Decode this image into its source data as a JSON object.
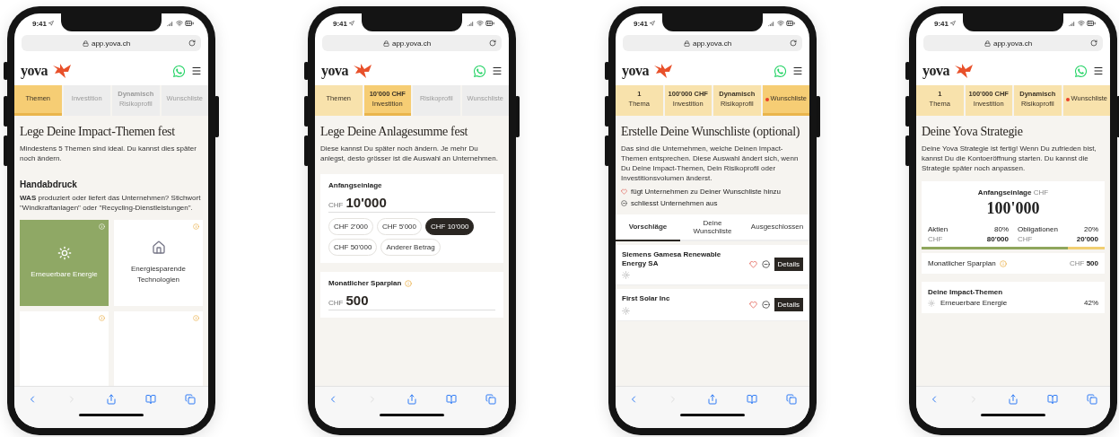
{
  "phones": [
    {
      "status_time": "9:41",
      "url": "app.yova.ch",
      "logo": "yova",
      "tabs": [
        {
          "label": "Themen",
          "done": true,
          "selected": true,
          "dot": false
        },
        {
          "label": "Investition",
          "done": false,
          "selected": false,
          "dot": false
        },
        {
          "title": "Dynamisch",
          "label": "Risikoprofil",
          "done": false,
          "selected": false,
          "dot": false
        },
        {
          "label": "Wunschliste",
          "done": false,
          "selected": false,
          "dot": false
        }
      ],
      "content": {
        "kind": "themes",
        "heading": "Lege Deine Impact-Themen fest",
        "intro": "Mindestens 5 Themen sind ideal. Du kannst dies später noch ändern.",
        "section_title": "Handabdruck",
        "section_text": "**WAS** produziert oder liefert das Unternehmen? Stichwort \"Windkraftanlagen\" oder \"Recycling-Dienstleistungen\".",
        "cards": [
          {
            "label": "Erneuerbare Energie",
            "selected": true
          },
          {
            "label": "Energiesparende Technologien",
            "selected": false
          },
          {
            "selected": false
          },
          {
            "selected": false
          }
        ]
      }
    },
    {
      "status_time": "9:41",
      "url": "app.yova.ch",
      "logo": "yova",
      "tabs": [
        {
          "label": "Themen",
          "done": true,
          "selected": false,
          "dot": false
        },
        {
          "title": "10'000 CHF",
          "label": "Investition",
          "done": true,
          "selected": true,
          "dot": false
        },
        {
          "label": "Risikoprofil",
          "done": false,
          "selected": false,
          "dot": false
        },
        {
          "label": "Wunschliste",
          "done": false,
          "selected": false,
          "dot": false
        }
      ],
      "content": {
        "kind": "amount",
        "heading": "Lege Deine Anlagesumme fest",
        "intro": "Diese kannst Du später noch ändern. Je mehr Du anlegst, desto grösser ist die Auswahl an Unternehmen.",
        "fields": [
          {
            "label": "Anfangseinlage",
            "info": false,
            "currency": "CHF",
            "value": "10'000",
            "chips": [
              {
                "label": "CHF 2'000",
                "selected": false
              },
              {
                "label": "CHF 5'000",
                "selected": false
              },
              {
                "label": "CHF 10'000",
                "selected": true
              },
              {
                "label": "CHF 50'000",
                "selected": false
              },
              {
                "label": "Anderer Betrag",
                "selected": false
              }
            ]
          },
          {
            "label": "Monatlicher Sparplan",
            "info": true,
            "currency": "CHF",
            "value": "500"
          }
        ]
      }
    },
    {
      "status_time": "9:41",
      "url": "app.yova.ch",
      "logo": "yova",
      "tabs": [
        {
          "title": "1",
          "label": "Thema",
          "done": true,
          "selected": false,
          "dot": false
        },
        {
          "title": "100'000 CHF",
          "label": "Investition",
          "done": true,
          "selected": false,
          "dot": false
        },
        {
          "title": "Dynamisch",
          "label": "Risikoprofil",
          "done": true,
          "selected": false,
          "dot": false
        },
        {
          "label": "Wunschliste",
          "done": true,
          "selected": true,
          "dot": true
        }
      ],
      "content": {
        "kind": "wishlist",
        "heading": "Erstelle Deine Wunschliste (optional)",
        "intro": "Das sind die Unternehmen, welche Deinen Impact-Themen entsprechen. Diese Auswahl ändert sich, wenn Du Deine Impact-Themen, Dein Risikoprofil oder Investitionsvolumen änderst.",
        "legend": [
          {
            "kind": "heart",
            "text": "fügt Unternehmen zu Deiner Wunschliste hinzu"
          },
          {
            "kind": "exclude",
            "text": "schliesst Unternehmen aus"
          }
        ],
        "list_tabs": [
          {
            "label": "Vorschläge",
            "selected": true
          },
          {
            "label": "Deine Wunschliste",
            "selected": false
          },
          {
            "label": "Ausgeschlossen",
            "selected": false
          }
        ],
        "companies": [
          {
            "name": "Siemens Gamesa Renewable Energy SA",
            "button": "Details"
          },
          {
            "name": "First Solar Inc",
            "button": "Details"
          }
        ]
      }
    },
    {
      "status_time": "9:41",
      "url": "app.yova.ch",
      "logo": "yova",
      "tabs": [
        {
          "title": "1",
          "label": "Thema",
          "done": true,
          "selected": false,
          "dot": false
        },
        {
          "title": "100'000 CHF",
          "label": "Investition",
          "done": true,
          "selected": false,
          "dot": false
        },
        {
          "title": "Dynamisch",
          "label": "Risikoprofil",
          "done": true,
          "selected": false,
          "dot": false
        },
        {
          "label": "Wunschliste",
          "done": true,
          "selected": false,
          "dot": true
        }
      ],
      "content": {
        "kind": "strategy",
        "heading": "Deine Yova Strategie",
        "intro": "Deine Yova Strategie ist fertig! Wenn Du zufrieden bist, kannst Du die Kontoeröffnung starten. Du kannst die Strategie später noch anpassen.",
        "summary_label": "Anfangseinlage",
        "summary_currency": "CHF",
        "summary_amount": "100'000",
        "allocations": [
          {
            "name": "Aktien",
            "share": "80%",
            "currency": "CHF",
            "amount": "80'000",
            "level": 0.8,
            "color": "#8fa65c"
          },
          {
            "name": "Obligationen",
            "share": "20%",
            "currency": "CHF",
            "amount": "20'000",
            "level": 0.2,
            "color": "#f1cf72"
          }
        ],
        "savings": {
          "label": "Monatlicher Sparplan",
          "currency": "CHF",
          "value": "500"
        },
        "impact_title": "Deine Impact-Themen",
        "impact": [
          {
            "name": "Erneuerbare Energie",
            "share": "42%"
          }
        ]
      }
    }
  ]
}
